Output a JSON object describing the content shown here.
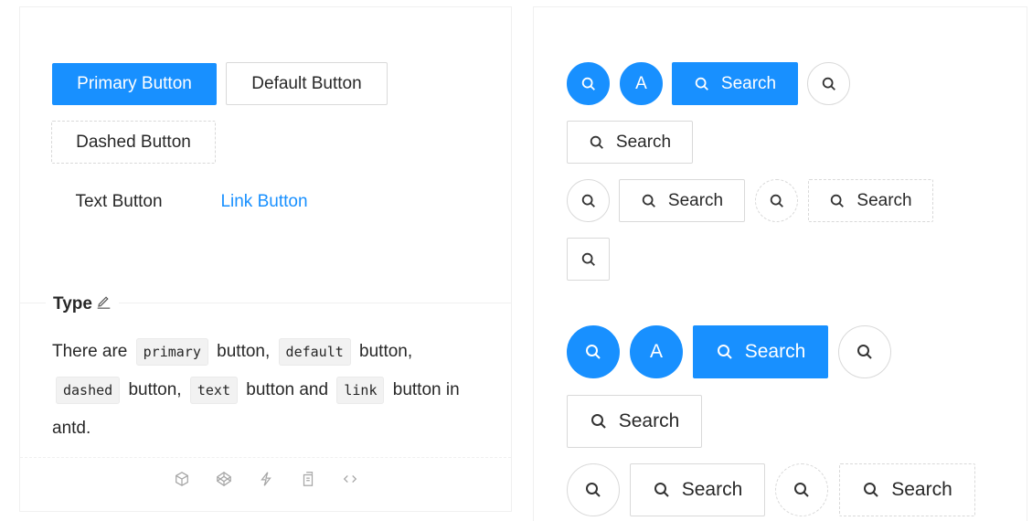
{
  "left_demo": {
    "primary_label": "Primary Button",
    "default_label": "Default Button",
    "dashed_label": "Dashed Button",
    "text_label": "Text Button",
    "link_label": "Link Button"
  },
  "meta": {
    "title": "Type",
    "desc_1": "There are",
    "code_primary": "primary",
    "desc_2": "button,",
    "code_default": "default",
    "desc_3": "button,",
    "code_dashed": "dashed",
    "desc_4": "button,",
    "code_text": "text",
    "desc_5": "button and",
    "code_link": "link",
    "desc_6": "button in antd."
  },
  "right_demo": {
    "search_label": "Search",
    "avatar_letter": "A"
  },
  "colors": {
    "primary": "#1890ff",
    "border": "#d9d9d9",
    "card_border": "#f0f0f0"
  },
  "icons": {
    "search": "search-icon",
    "edit": "edit-icon",
    "actions": [
      "codesandbox-icon",
      "codepen-icon",
      "thunderbolt-icon",
      "copy-icon",
      "code-icon"
    ]
  }
}
